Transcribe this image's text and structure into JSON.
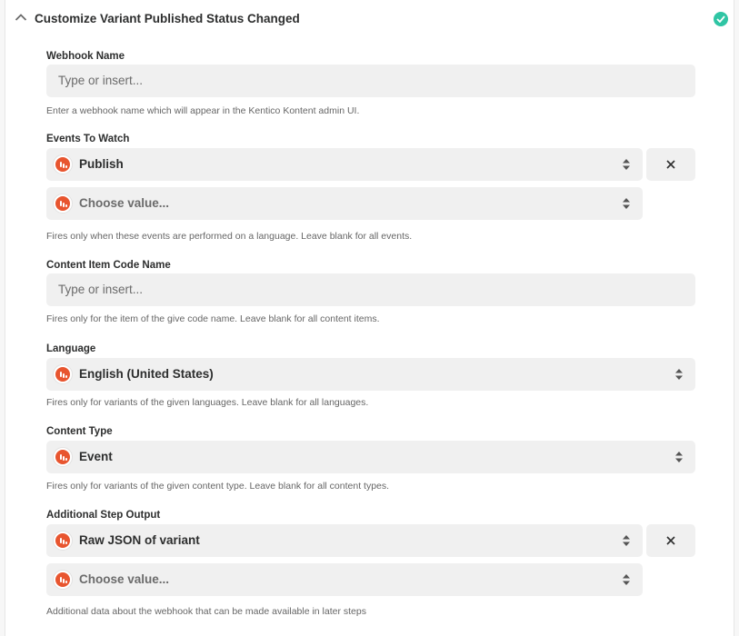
{
  "header": {
    "title": "Customize Variant Published Status Changed"
  },
  "fields": {
    "webhook_name": {
      "label": "Webhook Name",
      "placeholder": "Type or insert...",
      "help": "Enter a webhook name which will appear in the Kentico Kontent admin UI."
    },
    "events": {
      "label": "Events To Watch",
      "selected": "Publish",
      "placeholder": "Choose value...",
      "help": "Fires only when these events are performed on a language. Leave blank for all events."
    },
    "content_item": {
      "label": "Content Item Code Name",
      "placeholder": "Type or insert...",
      "help": "Fires only for the item of the give code name. Leave blank for all content items."
    },
    "language": {
      "label": "Language",
      "selected": "English (United States)",
      "help": "Fires only for variants of the given languages. Leave blank for all languages."
    },
    "content_type": {
      "label": "Content Type",
      "selected": "Event",
      "help": "Fires only for variants of the given content type. Leave blank for all content types."
    },
    "additional_output": {
      "label": "Additional Step Output",
      "selected": "Raw JSON of variant",
      "placeholder": "Choose value...",
      "help": "Additional data about the webhook that can be made available in later steps"
    }
  },
  "icons": {
    "app": "kentico-kontent-icon",
    "status": "check-circle-icon",
    "collapse": "chevron-up-icon",
    "sort": "up-down-arrows-icon",
    "remove": "close-icon"
  },
  "colors": {
    "accent_success": "#2fc5a4",
    "app_brand": "#e8552f",
    "field_bg": "#f0f0f0"
  }
}
